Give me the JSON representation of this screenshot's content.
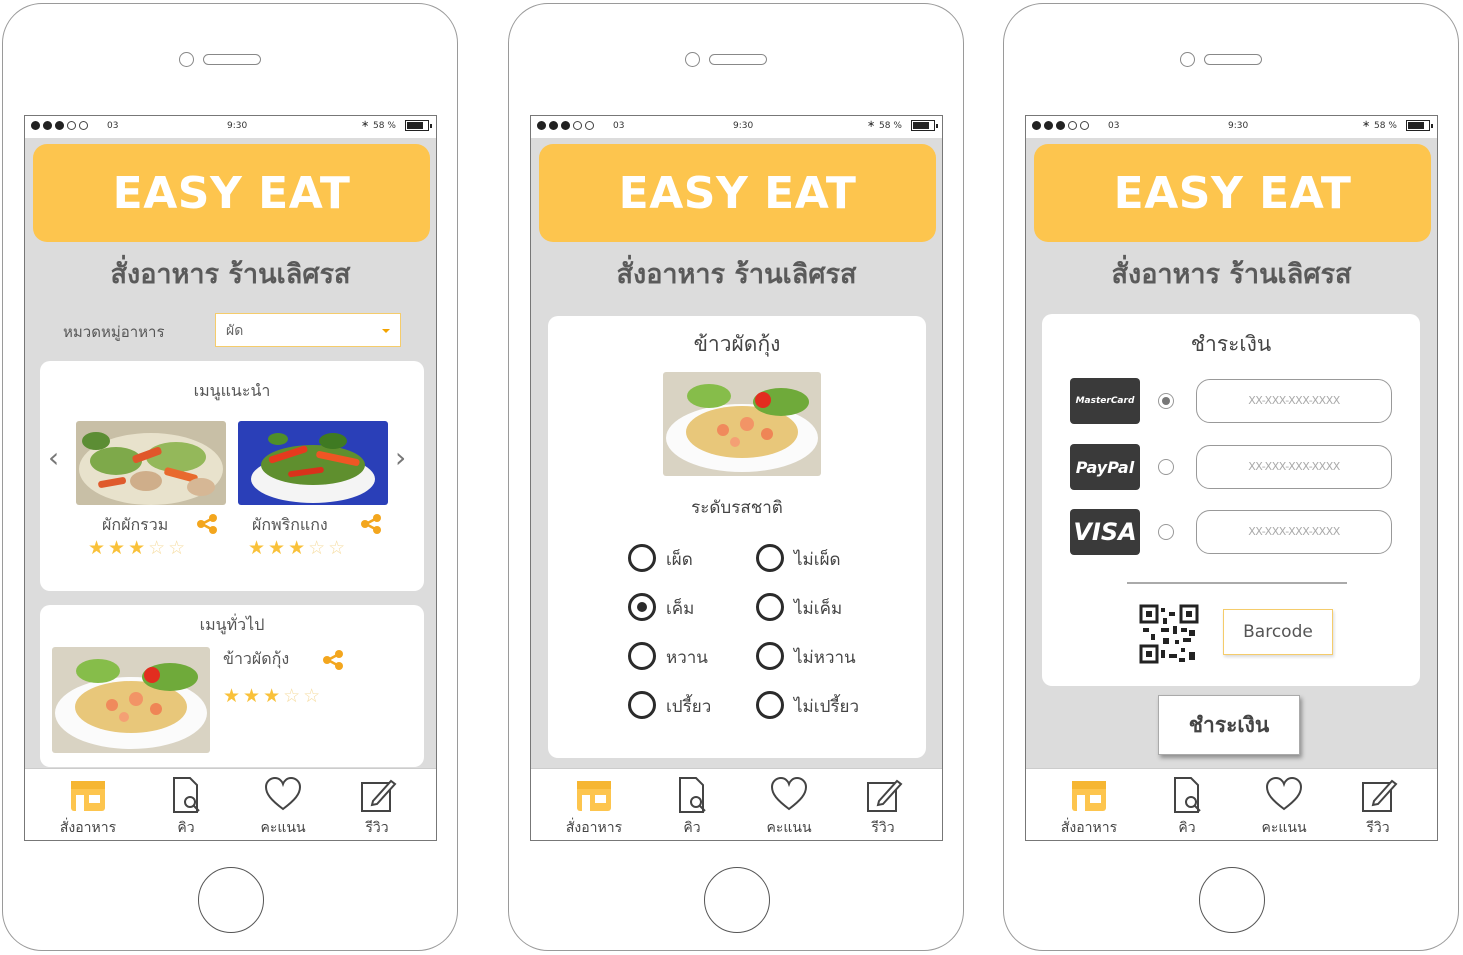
{
  "status_bar": {
    "carrier": "03",
    "time": "9:30",
    "battery": "58 %"
  },
  "app": {
    "name": "EASY EAT",
    "subtitle": "สั่งอาหาร ร้านเลิศรส"
  },
  "tabs": [
    {
      "label": "สั่งอาหาร",
      "icon": "store-icon"
    },
    {
      "label": "คิว",
      "icon": "document-search-icon"
    },
    {
      "label": "คะแนน",
      "icon": "heart-icon"
    },
    {
      "label": "รีวิว",
      "icon": "edit-icon"
    }
  ],
  "screen1": {
    "category_label": "หมวดหมู่อาหาร",
    "category_value": "ผัด",
    "recommended_title": "เมนูแนะนำ",
    "recommended": [
      {
        "name": "ผักผักรวม",
        "rating": 3,
        "max": 5
      },
      {
        "name": "ผักพริกแกง",
        "rating": 3,
        "max": 5
      }
    ],
    "general_title": "เมนูทั่วไป",
    "general": [
      {
        "name": "ข้าวผัดกุ้ง",
        "rating": 3,
        "max": 5
      }
    ]
  },
  "screen2": {
    "dish_title": "ข้าวผัดกุ้ง",
    "taste_label": "ระดับรสชาติ",
    "options": [
      {
        "label": "เผ็ด",
        "checked": false
      },
      {
        "label": "ไม่เผ็ด",
        "checked": false
      },
      {
        "label": "เค็ม",
        "checked": true
      },
      {
        "label": "ไม่เค็ม",
        "checked": false
      },
      {
        "label": "หวาน",
        "checked": false
      },
      {
        "label": "ไม่หวาน",
        "checked": false
      },
      {
        "label": "เปรี้ยว",
        "checked": false
      },
      {
        "label": "ไม่เปรี้ยว",
        "checked": false
      }
    ]
  },
  "screen3": {
    "title": "ชำระเงิน",
    "methods": [
      {
        "brand": "MasterCard",
        "selected": true,
        "placeholder": "XX-XXX-XXX-XXXX"
      },
      {
        "brand": "PayPal",
        "selected": false,
        "placeholder": "XX-XXX-XXX-XXXX"
      },
      {
        "brand": "VISA",
        "selected": false,
        "placeholder": "XX-XXX-XXX-XXXX"
      }
    ],
    "barcode_button": "Barcode",
    "pay_button": "ชำระเงิน"
  },
  "colors": {
    "accent": "#fdc54e",
    "screen_bg": "#dcdcdc",
    "star": "#f9c13a"
  }
}
